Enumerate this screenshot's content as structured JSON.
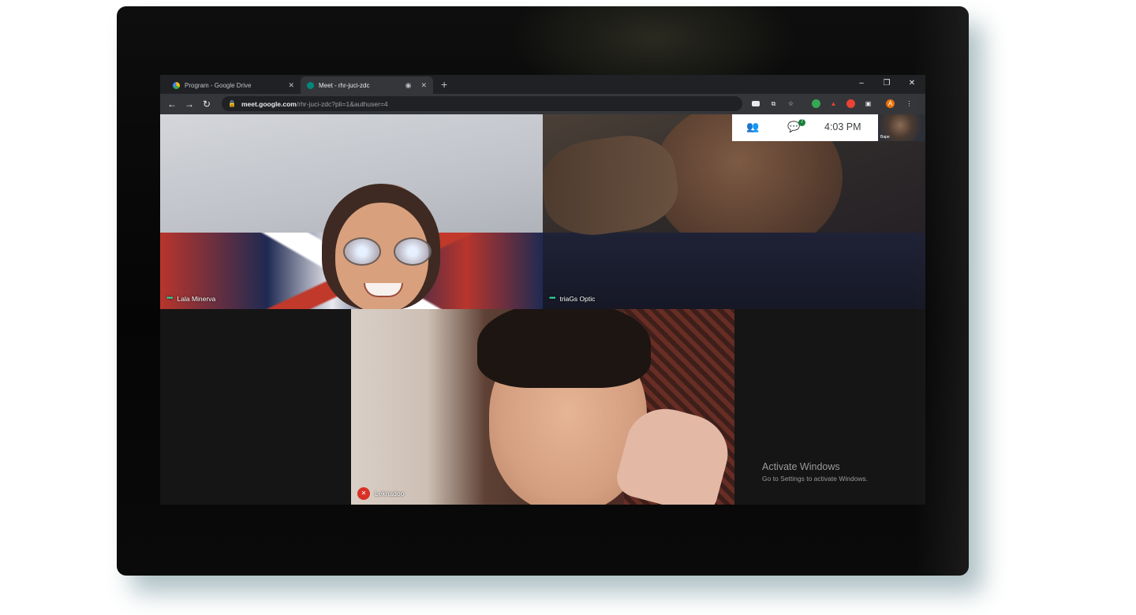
{
  "browser": {
    "tabs": [
      {
        "label": "Program - Google Drive",
        "favicon": "google-drive-icon",
        "active": false
      },
      {
        "label": "Meet - rhr-juci-zdc",
        "favicon": "meet-icon",
        "active": true
      }
    ],
    "url_host": "meet.google.com",
    "url_path": "/rhr-juci-zdc?pli=1&authuser=4",
    "profile_initial": "A"
  },
  "meet": {
    "time": "4:03 PM",
    "chat_badge": "7",
    "self_view_label": "Bape",
    "participants": [
      {
        "name": "Lala Minerva"
      },
      {
        "name": "triaGs Optic"
      },
      {
        "name": "Leknadoo",
        "muted": true
      }
    ]
  },
  "watermark": {
    "title": "Activate Windows",
    "subtitle": "Go to Settings to activate Windows."
  },
  "colors": {
    "accent_green": "#34d399",
    "mute_red": "#d93025",
    "chat_badge_green": "#188038"
  }
}
